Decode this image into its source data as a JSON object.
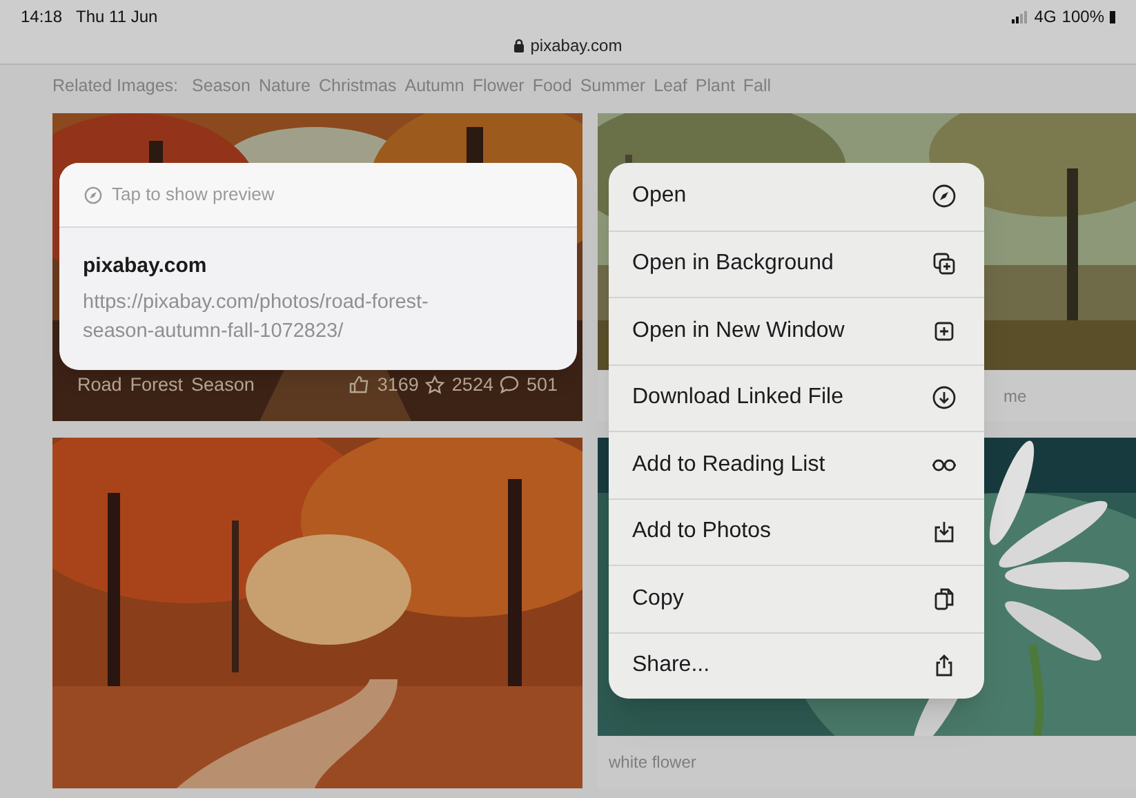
{
  "status_bar": {
    "time": "14:18",
    "date": "Thu 11 Jun",
    "network": "4G",
    "battery": "100%"
  },
  "address_bar": {
    "url": "pixabay.com"
  },
  "related_images": {
    "label": "Related Images:",
    "tags": [
      "Season",
      "Nature",
      "Christmas",
      "Autumn",
      "Flower",
      "Food",
      "Summer",
      "Leaf",
      "Plant",
      "Fall"
    ]
  },
  "images": [
    {
      "kind": "autumn-forest",
      "tags": [
        "Road",
        "Forest",
        "Season"
      ],
      "stats": [
        {
          "kind": "like",
          "value": "3169"
        },
        {
          "kind": "favorite",
          "value": "2524"
        },
        {
          "kind": "comment",
          "value": "501"
        }
      ]
    },
    {
      "kind": "green-forest",
      "caption": "me"
    },
    {
      "kind": "autumn-road"
    },
    {
      "kind": "daisy",
      "caption": "white flower"
    }
  ],
  "link_preview": {
    "hint": "Tap to show preview",
    "title": "pixabay.com",
    "url": "https://pixabay.com/photos/road-forest-season-autumn-fall-1072823/"
  },
  "context_menu": [
    {
      "label": "Open",
      "kind": "open"
    },
    {
      "label": "Open in Background",
      "kind": "background"
    },
    {
      "label": "Open in New Window",
      "kind": "new-window"
    },
    {
      "label": "Download Linked File",
      "kind": "download"
    },
    {
      "label": "Add to Reading List",
      "kind": "reading-list"
    },
    {
      "label": "Add to Photos",
      "kind": "photos"
    },
    {
      "label": "Copy",
      "kind": "copy"
    },
    {
      "label": "Share...",
      "kind": "share"
    }
  ]
}
